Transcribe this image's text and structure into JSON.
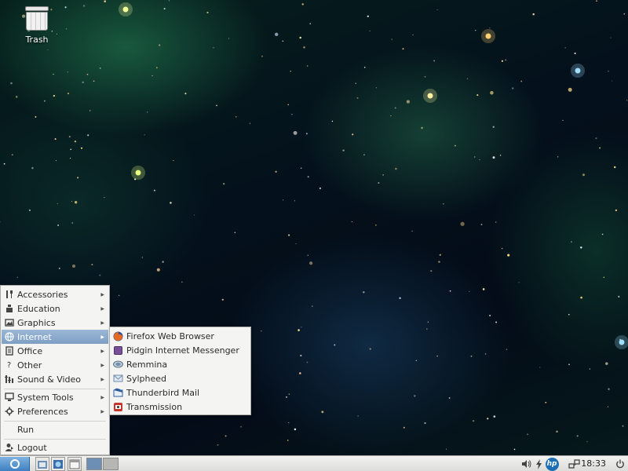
{
  "desktop": {
    "icons": [
      {
        "label": "Trash",
        "icon": "trash-icon"
      }
    ]
  },
  "main_menu": {
    "items": [
      {
        "label": "Accessories",
        "icon": "accessories-icon",
        "submenu": true
      },
      {
        "label": "Education",
        "icon": "education-icon",
        "submenu": true
      },
      {
        "label": "Graphics",
        "icon": "graphics-icon",
        "submenu": true
      },
      {
        "label": "Internet",
        "icon": "globe-icon",
        "submenu": true,
        "selected": true
      },
      {
        "label": "Office",
        "icon": "office-icon",
        "submenu": true
      },
      {
        "label": "Other",
        "icon": "question-icon",
        "submenu": true
      },
      {
        "label": "Sound & Video",
        "icon": "sound-video-icon",
        "submenu": true
      },
      {
        "label": "System Tools",
        "icon": "monitor-icon",
        "submenu": true
      },
      {
        "label": "Preferences",
        "icon": "gear-icon",
        "submenu": true
      },
      {
        "label": "Run",
        "icon": "",
        "submenu": false
      },
      {
        "label": "Logout",
        "icon": "logout-icon",
        "submenu": false
      }
    ]
  },
  "internet_submenu": {
    "items": [
      {
        "label": "Firefox Web Browser",
        "icon": "firefox-icon",
        "color": "#e66a1f"
      },
      {
        "label": "Pidgin Internet Messenger",
        "icon": "pidgin-icon",
        "color": "#7a4f9a"
      },
      {
        "label": "Remmina",
        "icon": "remmina-icon",
        "color": "#6f8fa8"
      },
      {
        "label": "Sylpheed",
        "icon": "sylpheed-icon",
        "color": "#8aa7c8"
      },
      {
        "label": "Thunderbird Mail",
        "icon": "thunderbird-icon",
        "color": "#2c5f9e"
      },
      {
        "label": "Transmission",
        "icon": "transmission-icon",
        "color": "#c8352b"
      }
    ]
  },
  "taskbar": {
    "start_icon": "menu-gear-icon",
    "launchers": [
      "file-manager-icon",
      "browser-icon",
      "window-icon"
    ],
    "workspaces": 2,
    "tray": [
      "volume-icon",
      "power-plug-icon",
      "hp-icon",
      "network-icon"
    ],
    "hp_text": "hp",
    "clock": "18:33",
    "shutdown_icon": "power-icon"
  },
  "colors": {
    "selection": "#7d9ec4",
    "start_button": "#3f7fc2",
    "menu_background": "#f4f4f3"
  }
}
